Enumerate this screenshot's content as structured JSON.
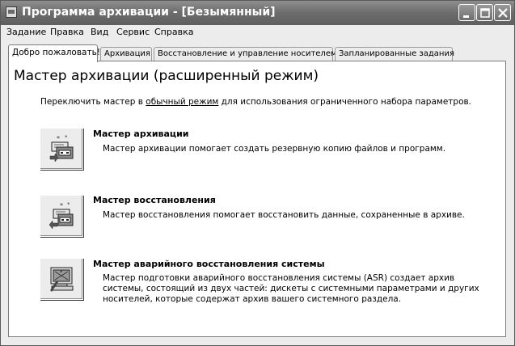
{
  "window": {
    "title": "Программа архивации - [Безымянный]",
    "controls": {
      "minimize": "minimize-icon",
      "maximize": "maximize-icon",
      "close": "close-icon"
    }
  },
  "menu": [
    "Задание",
    "Правка",
    "Вид",
    "Сервис",
    "Справка"
  ],
  "tabs": [
    {
      "label": "Добро пожаловать!",
      "active": true
    },
    {
      "label": "Архивация",
      "active": false
    },
    {
      "label": "Восстановление и управление носителем",
      "active": false
    },
    {
      "label": "Запланированные задания",
      "active": false
    }
  ],
  "welcome": {
    "heading": "Мастер архивации (расширенный режим)",
    "switch_prefix": "Переключить мастер в ",
    "switch_link": "обычный режим",
    "switch_suffix": " для использования ограниченного набора параметров."
  },
  "wizards": [
    {
      "title": "Мастер архивации",
      "description": "Мастер архивации помогает создать резервную копию файлов и программ.",
      "icon": "backup-wizard-icon"
    },
    {
      "title": "Мастер восстановления",
      "description": "Мастер восстановления помогает восстановить данные, сохраненные в архиве.",
      "icon": "restore-wizard-icon"
    },
    {
      "title": "Мастер аварийного восстановления системы",
      "description": "Мастер подготовки аварийного восстановления системы (ASR) создает архив системы, состоящий из двух частей: дискеты с системными параметрами и других носителей, которые содержат архив вашего системного раздела.",
      "icon": "asr-wizard-icon"
    }
  ]
}
